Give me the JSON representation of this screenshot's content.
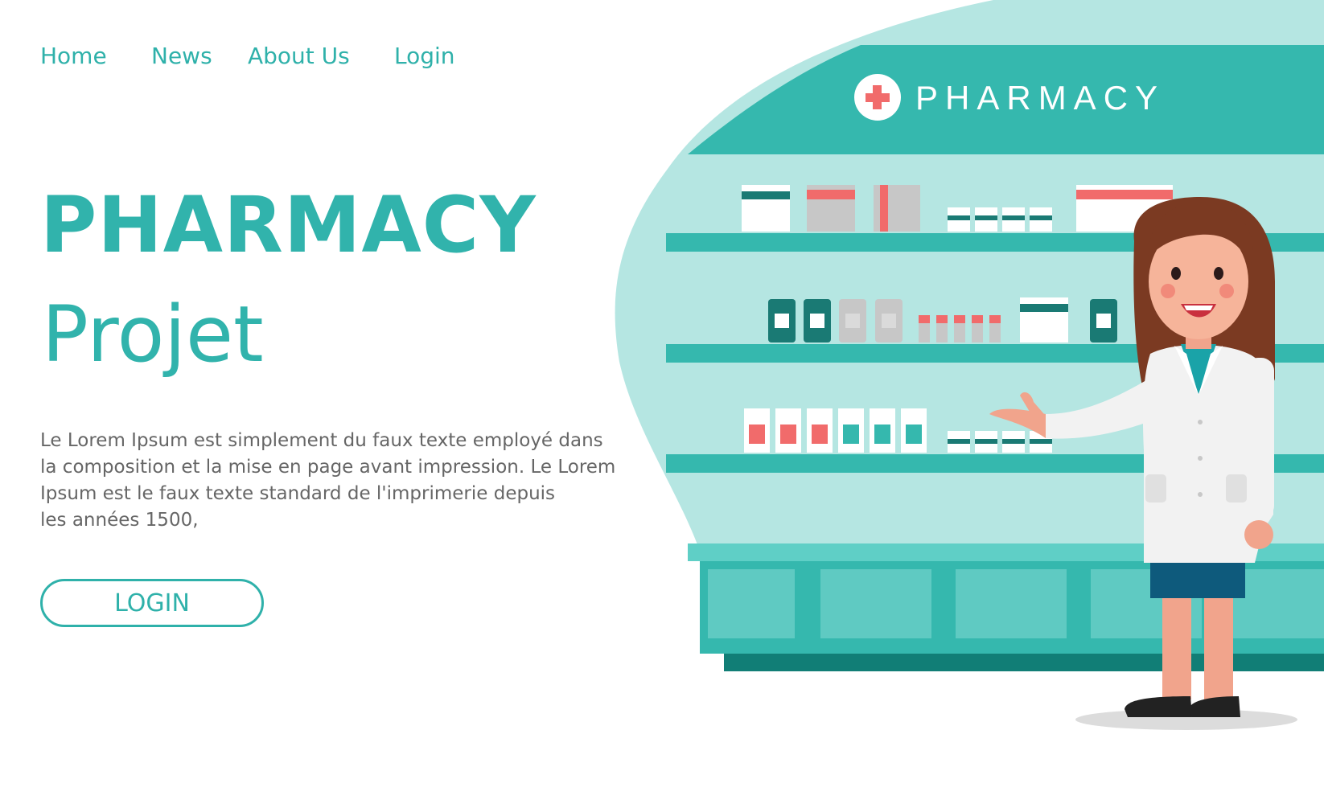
{
  "nav": {
    "items": [
      {
        "label": "Home"
      },
      {
        "label": "News"
      },
      {
        "label": "About Us"
      },
      {
        "label": "Login"
      }
    ]
  },
  "hero": {
    "title": "PHARMACY",
    "subtitle": "Projet",
    "description": "Le Lorem Ipsum est simplement du faux texte employé dans\n la composition et la mise en page avant impression. Le Lorem\nIpsum est le faux texte standard de l'imprimerie depuis\n les années 1500,",
    "cta_label": "LOGIN"
  },
  "illustration": {
    "sign_text": "PHARMACY"
  },
  "colors": {
    "accent": "#31b3ac",
    "text_muted": "#666666",
    "blob": "#b5e6e2",
    "shelf": "#35b8ae"
  }
}
